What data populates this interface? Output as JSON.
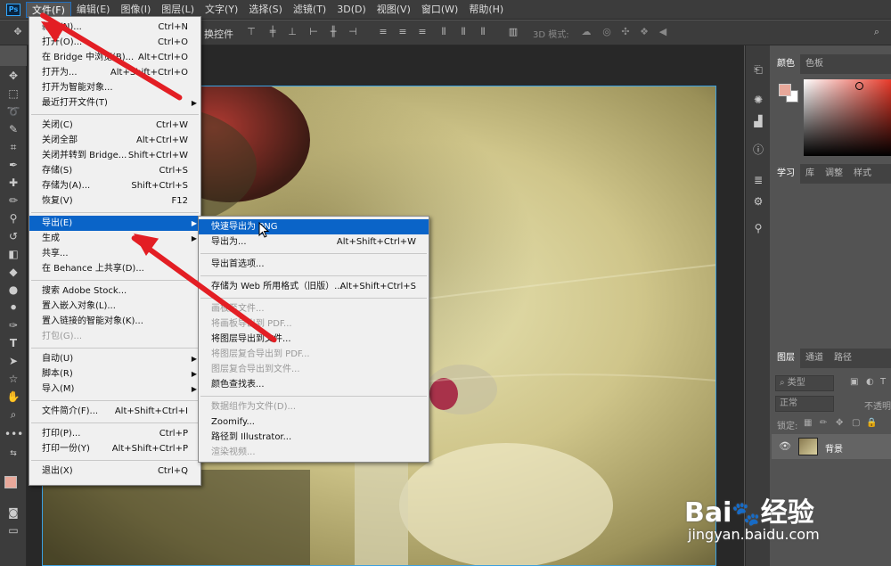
{
  "app": {
    "logo": "Ps"
  },
  "menubar": [
    {
      "label": "文件(F)",
      "active": true
    },
    {
      "label": "编辑(E)"
    },
    {
      "label": "图像(I)"
    },
    {
      "label": "图层(L)"
    },
    {
      "label": "文字(Y)"
    },
    {
      "label": "选择(S)"
    },
    {
      "label": "滤镜(T)"
    },
    {
      "label": "3D(D)"
    },
    {
      "label": "视图(V)"
    },
    {
      "label": "窗口(W)"
    },
    {
      "label": "帮助(H)"
    }
  ],
  "options_bar": {
    "transform_label": "换控件",
    "mode_3d": "3D 模式:"
  },
  "file_menu": [
    {
      "label": "新建(N)...",
      "shortcut": "Ctrl+N"
    },
    {
      "label": "打开(O)...",
      "shortcut": "Ctrl+O"
    },
    {
      "label": "在 Bridge 中浏览(B)...",
      "shortcut": "Alt+Ctrl+O"
    },
    {
      "label": "打开为...",
      "shortcut": "Alt+Shift+Ctrl+O"
    },
    {
      "label": "打开为智能对象..."
    },
    {
      "label": "最近打开文件(T)",
      "submenu": true
    },
    {
      "sep": true
    },
    {
      "label": "关闭(C)",
      "shortcut": "Ctrl+W"
    },
    {
      "label": "关闭全部",
      "shortcut": "Alt+Ctrl+W"
    },
    {
      "label": "关闭并转到 Bridge...",
      "shortcut": "Shift+Ctrl+W"
    },
    {
      "label": "存储(S)",
      "shortcut": "Ctrl+S"
    },
    {
      "label": "存储为(A)...",
      "shortcut": "Shift+Ctrl+S"
    },
    {
      "label": "恢复(V)",
      "shortcut": "F12"
    },
    {
      "sep": true
    },
    {
      "label": "导出(E)",
      "submenu": true,
      "highlighted": true
    },
    {
      "label": "生成",
      "submenu": true
    },
    {
      "label": "共享..."
    },
    {
      "label": "在 Behance 上共享(D)..."
    },
    {
      "sep": true
    },
    {
      "label": "搜索 Adobe Stock..."
    },
    {
      "label": "置入嵌入对象(L)..."
    },
    {
      "label": "置入链接的智能对象(K)..."
    },
    {
      "label": "打包(G)...",
      "disabled": true
    },
    {
      "sep": true
    },
    {
      "label": "自动(U)",
      "submenu": true
    },
    {
      "label": "脚本(R)",
      "submenu": true
    },
    {
      "label": "导入(M)",
      "submenu": true
    },
    {
      "sep": true
    },
    {
      "label": "文件简介(F)...",
      "shortcut": "Alt+Shift+Ctrl+I"
    },
    {
      "sep": true
    },
    {
      "label": "打印(P)...",
      "shortcut": "Ctrl+P"
    },
    {
      "label": "打印一份(Y)",
      "shortcut": "Alt+Shift+Ctrl+P"
    },
    {
      "sep": true
    },
    {
      "label": "退出(X)",
      "shortcut": "Ctrl+Q"
    }
  ],
  "export_menu": [
    {
      "label": "快速导出为 PNG",
      "highlighted": true
    },
    {
      "label": "导出为...",
      "shortcut": "Alt+Shift+Ctrl+W"
    },
    {
      "sep": true
    },
    {
      "label": "导出首选项..."
    },
    {
      "sep": true
    },
    {
      "label": "存储为 Web 所用格式（旧版）...",
      "shortcut": "Alt+Shift+Ctrl+S"
    },
    {
      "sep": true
    },
    {
      "label": "画板至文件...",
      "disabled": true
    },
    {
      "label": "将画板导出到 PDF...",
      "disabled": true
    },
    {
      "label": "将图层导出到文件..."
    },
    {
      "label": "将图层复合导出到 PDF...",
      "disabled": true
    },
    {
      "label": "图层复合导出到文件...",
      "disabled": true
    },
    {
      "label": "颜色查找表..."
    },
    {
      "sep": true
    },
    {
      "label": "数据组作为文件(D)...",
      "disabled": true
    },
    {
      "label": "Zoomify..."
    },
    {
      "label": "路径到 Illustrator..."
    },
    {
      "label": "渲染视频...",
      "disabled": true
    }
  ],
  "color_panel": {
    "tabs": [
      "颜色",
      "色板"
    ],
    "foreground": "#e8a89a",
    "background": "#ffffff"
  },
  "learn_panel": {
    "tabs": [
      "学习",
      "库",
      "调整",
      "样式"
    ]
  },
  "layers_panel": {
    "tabs": [
      "图层",
      "通道",
      "路径"
    ],
    "filter_placeholder": "类型",
    "blend_mode": "正常",
    "opacity_label": "不透明",
    "lock_label": "锁定:",
    "layer_name": "背景"
  },
  "watermark": {
    "brand": "Bai",
    "brand_suffix": "经验",
    "url": "jingyan.baidu.com"
  },
  "colors": {
    "accent": "#0a64c8",
    "arrow": "#e31e24",
    "canvas_border": "#3aa0e0"
  }
}
